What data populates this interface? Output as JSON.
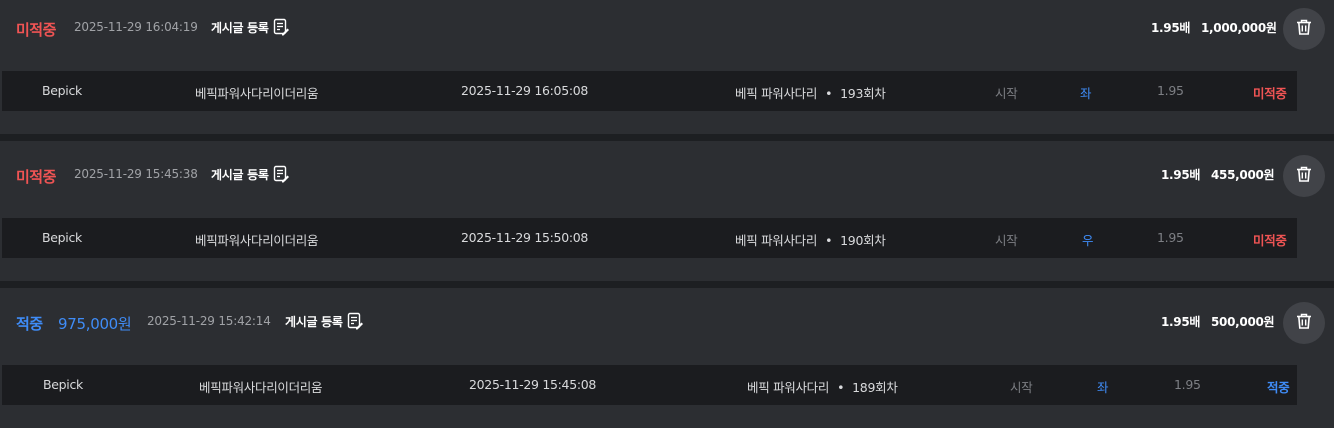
{
  "bets": [
    {
      "status": "미적중",
      "win_amount": "",
      "time": "2025-11-29 16:04:19",
      "post_label": "게시글 등록",
      "odds": "1.95배",
      "amount": "1,000,000원",
      "row": {
        "site": "Bepick",
        "game": "베픽파워사다리이더리움",
        "time": "2025-11-29 16:05:08",
        "game_name": "베픽 파워사다리",
        "round": "193회차",
        "pick_type": "시작",
        "pick": "좌",
        "odds": "1.95",
        "result": "미적중"
      }
    },
    {
      "status": "미적중",
      "win_amount": "",
      "time": "2025-11-29 15:45:38",
      "post_label": "게시글 등록",
      "odds": "1.95배",
      "amount": "455,000원",
      "row": {
        "site": "Bepick",
        "game": "베픽파워사다리이더리움",
        "time": "2025-11-29 15:50:08",
        "game_name": "베픽 파워사다리",
        "round": "190회차",
        "pick_type": "시작",
        "pick": "우",
        "odds": "1.95",
        "result": "미적중"
      }
    },
    {
      "status": "적중",
      "win_amount": "975,000원",
      "time": "2025-11-29 15:42:14",
      "post_label": "게시글 등록",
      "odds": "1.95배",
      "amount": "500,000원",
      "row": {
        "site": "Bepick",
        "game": "베픽파워사다리이더리움",
        "time": "2025-11-29 15:45:08",
        "game_name": "베픽 파워사다리",
        "round": "189회차",
        "pick_type": "시작",
        "pick": "좌",
        "odds": "1.95",
        "result": "적중"
      }
    }
  ],
  "separator": "•",
  "icons": {
    "post": "edit-note-icon",
    "delete": "trash-icon"
  },
  "colors": {
    "miss": "#f05454",
    "hit": "#3f8cf7",
    "background": "#2c2e32",
    "row": "#1b1c1f"
  }
}
